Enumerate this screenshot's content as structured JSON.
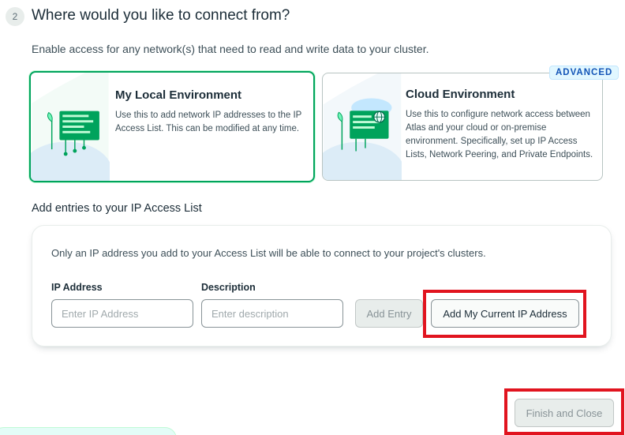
{
  "step": {
    "number": "2",
    "title": "Where would you like to connect from?",
    "subtitle": "Enable access for any network(s) that need to read and write data to your cluster."
  },
  "environments": {
    "local": {
      "title": "My Local Environment",
      "description": "Use this to add network IP addresses to the IP Access List. This can be modified at any time.",
      "selected": true,
      "icon": "local-network-illustration-icon"
    },
    "cloud": {
      "title": "Cloud Environment",
      "description": "Use this to configure network access between Atlas and your cloud or on-premise environment. Specifically, set up IP Access Lists, Network Peering, and Private Endpoints.",
      "badge": "ADVANCED",
      "icon": "cloud-network-illustration-icon"
    }
  },
  "access_list": {
    "heading": "Add entries to your IP Access List",
    "note": "Only an IP address you add to your Access List will be able to connect to your project's clusters.",
    "ip_label": "IP Address",
    "ip_placeholder": "Enter IP Address",
    "ip_value": "",
    "description_label": "Description",
    "description_placeholder": "Enter description",
    "description_value": "",
    "add_entry_label": "Add Entry",
    "add_current_ip_label": "Add My Current IP Address"
  },
  "footer": {
    "finish_label": "Finish and Close"
  },
  "colors": {
    "selected_border": "#00a35c",
    "annotation_red": "#e1141f",
    "badge_blue": "#1254b7"
  }
}
